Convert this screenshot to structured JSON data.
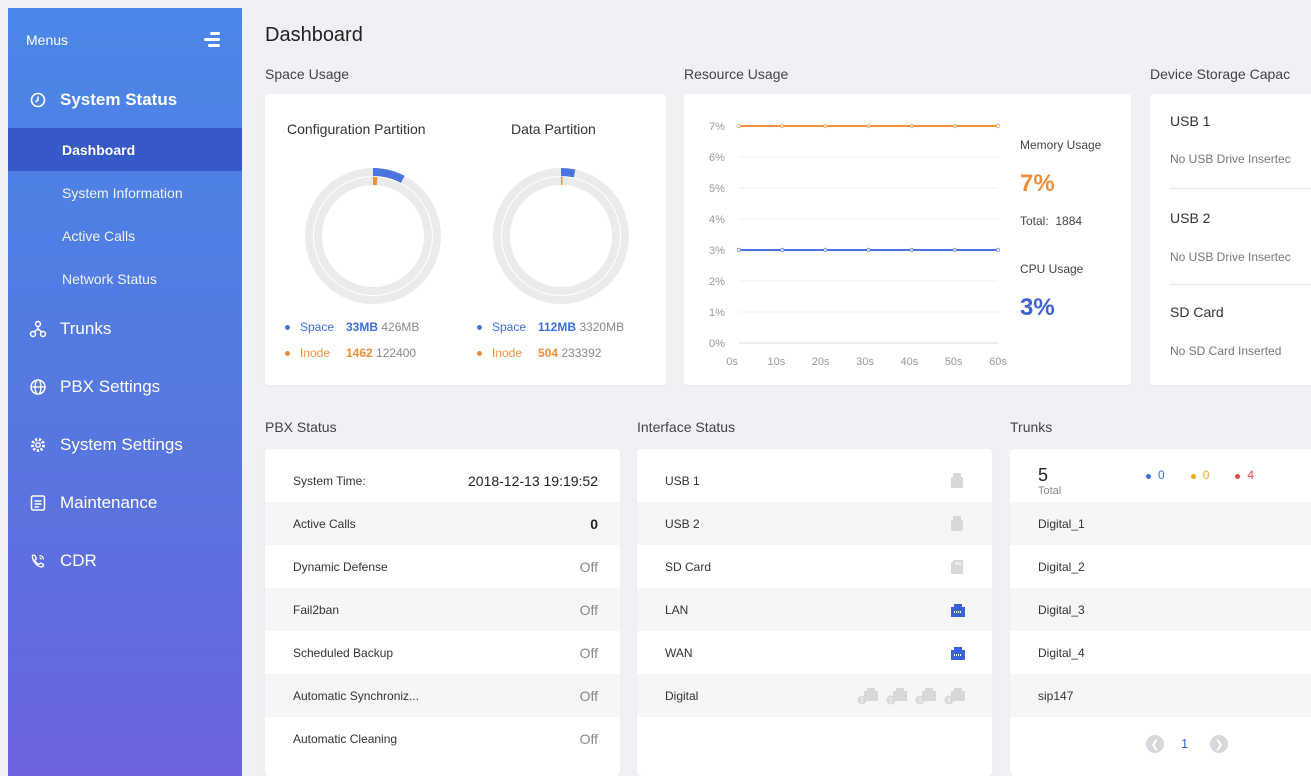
{
  "sidebar": {
    "menus_label": "Menus",
    "groups": [
      {
        "label": "System Status",
        "icon": "clock-icon"
      },
      {
        "label": "Trunks",
        "icon": "nodes-icon"
      },
      {
        "label": "PBX Settings",
        "icon": "globe-icon"
      },
      {
        "label": "System Settings",
        "icon": "gear-icon"
      },
      {
        "label": "Maintenance",
        "icon": "document-icon"
      },
      {
        "label": "CDR",
        "icon": "phone-icon"
      }
    ],
    "sub_items": [
      "Dashboard",
      "System Information",
      "Active Calls",
      "Network Status"
    ]
  },
  "page": {
    "title": "Dashboard"
  },
  "space_usage": {
    "label": "Space Usage",
    "config": {
      "title": "Configuration Partition",
      "space_label": "Space",
      "space_used": "33MB",
      "space_total": "426MB",
      "inode_label": "Inode",
      "inode_used": "1462",
      "inode_total": "122400",
      "space_fraction": 0.077,
      "inode_fraction": 0.012
    },
    "data": {
      "title": "Data Partition",
      "space_label": "Space",
      "space_used": "112MB",
      "space_total": "3320MB",
      "inode_label": "Inode",
      "inode_used": "504",
      "inode_total": "233392",
      "space_fraction": 0.034,
      "inode_fraction": 0.002
    }
  },
  "resource_usage": {
    "label": "Resource Usage",
    "memory_label": "Memory Usage",
    "memory_value": "7%",
    "total_label": "Total:",
    "total_value": "1884",
    "cpu_label": "CPU Usage",
    "cpu_value": "3%"
  },
  "chart_data": {
    "type": "line",
    "x": [
      "0s",
      "10s",
      "20s",
      "30s",
      "40s",
      "50s",
      "60s"
    ],
    "y_ticks": [
      "0%",
      "1%",
      "2%",
      "3%",
      "4%",
      "5%",
      "6%",
      "7%"
    ],
    "ylim": [
      0,
      7
    ],
    "series": [
      {
        "name": "Memory Usage",
        "color": "#f0933a",
        "values": [
          7,
          7,
          7,
          7,
          7,
          7,
          7,
          7,
          7,
          7,
          7,
          7,
          7
        ]
      },
      {
        "name": "CPU Usage",
        "color": "#4a72e0",
        "values": [
          3,
          3,
          3,
          3,
          3,
          3,
          3,
          3,
          3,
          3,
          3,
          3,
          3
        ]
      }
    ]
  },
  "device_storage": {
    "label": "Device Storage Capac",
    "items": [
      {
        "name": "USB 1",
        "note": "No USB Drive Insertec"
      },
      {
        "name": "USB 2",
        "note": "No USB Drive Insertec"
      },
      {
        "name": "SD Card",
        "note": "No SD Card Inserted"
      }
    ]
  },
  "pbx_status": {
    "label": "PBX Status",
    "rows": [
      {
        "key": "System Time:",
        "value": "2018-12-13 19:19:52"
      },
      {
        "key": "Active Calls",
        "value": "0"
      },
      {
        "key": "Dynamic Defense",
        "value": "Off"
      },
      {
        "key": "Fail2ban",
        "value": "Off"
      },
      {
        "key": "Scheduled Backup",
        "value": "Off"
      },
      {
        "key": "Automatic Synchroniz...",
        "value": "Off"
      },
      {
        "key": "Automatic Cleaning",
        "value": "Off"
      }
    ]
  },
  "interface_status": {
    "label": "Interface Status",
    "rows": [
      {
        "name": "USB 1",
        "icon": "usb-icon",
        "active": false
      },
      {
        "name": "USB 2",
        "icon": "usb-icon",
        "active": false
      },
      {
        "name": "SD Card",
        "icon": "sd-card-icon",
        "active": false
      },
      {
        "name": "LAN",
        "icon": "ethernet-port-icon",
        "active": true
      },
      {
        "name": "WAN",
        "icon": "ethernet-port-icon",
        "active": true
      },
      {
        "name": "Digital",
        "icon": "digital-port-icon",
        "active": false,
        "ports": [
          "1",
          "2",
          "3",
          "4"
        ]
      }
    ]
  },
  "trunks": {
    "label": "Trunks",
    "total_count": "5",
    "total_label": "Total",
    "status_counts": [
      {
        "value": "0",
        "color": "#3a6fe0"
      },
      {
        "value": "0",
        "color": "#f5a623"
      },
      {
        "value": "4",
        "color": "#e8474b"
      }
    ],
    "rows": [
      "Digital_1",
      "Digital_2",
      "Digital_3",
      "Digital_4",
      "sip147"
    ],
    "page": "1"
  }
}
